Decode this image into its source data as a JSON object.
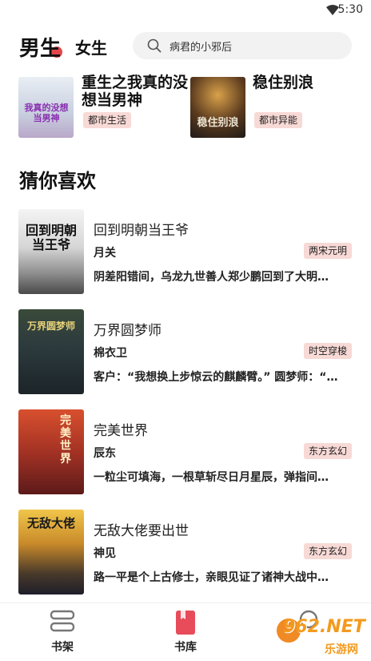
{
  "status": {
    "time": "5:30"
  },
  "header": {
    "tab_male": "男生",
    "tab_female": "女生",
    "search_placeholder": "病君的小邪后"
  },
  "top_books": [
    {
      "title_line1": "重生之我真的没",
      "title_line2": "想当男神",
      "tag": "都市生活",
      "cover_text": "我真的没想当男神"
    },
    {
      "title_line1": "稳住别浪",
      "title_line2": "",
      "tag": "都市异能",
      "cover_text": "稳住别浪"
    }
  ],
  "section_title": "猜你喜欢",
  "books": [
    {
      "title": "回到明朝当王爷",
      "author": "月关",
      "tag": "两宋元明",
      "desc": "阴差阳错间，乌龙九世善人郑少鹏回到了大明…",
      "cover_text": "回到明朝当王爷"
    },
    {
      "title": "万界圆梦师",
      "author": "棉衣卫",
      "tag": "时空穿梭",
      "desc": "客户：“我想换上步惊云的麒麟臂。” 圆梦师：“…",
      "cover_text": "万界圆梦师"
    },
    {
      "title": "完美世界",
      "author": "辰东",
      "tag": "东方玄幻",
      "desc": "一粒尘可填海，一根草斩尽日月星辰，弹指间…",
      "cover_text": "完美世界"
    },
    {
      "title": "无敌大佬要出世",
      "author": "神见",
      "tag": "东方玄幻",
      "desc": "路一平是个上古修士，亲眼见证了诸神大战中…",
      "cover_text": "无敌大佬"
    }
  ],
  "bottom_nav": [
    {
      "label": "书架",
      "active": false
    },
    {
      "label": "书库",
      "active": true
    },
    {
      "label": "",
      "active": false
    }
  ],
  "watermark": {
    "text": "962.NET",
    "subtext": "乐游网"
  },
  "colors": {
    "accent": "#e3464a",
    "tag_bg": "#f7d9d6",
    "nav_active": "#e84b5a"
  }
}
